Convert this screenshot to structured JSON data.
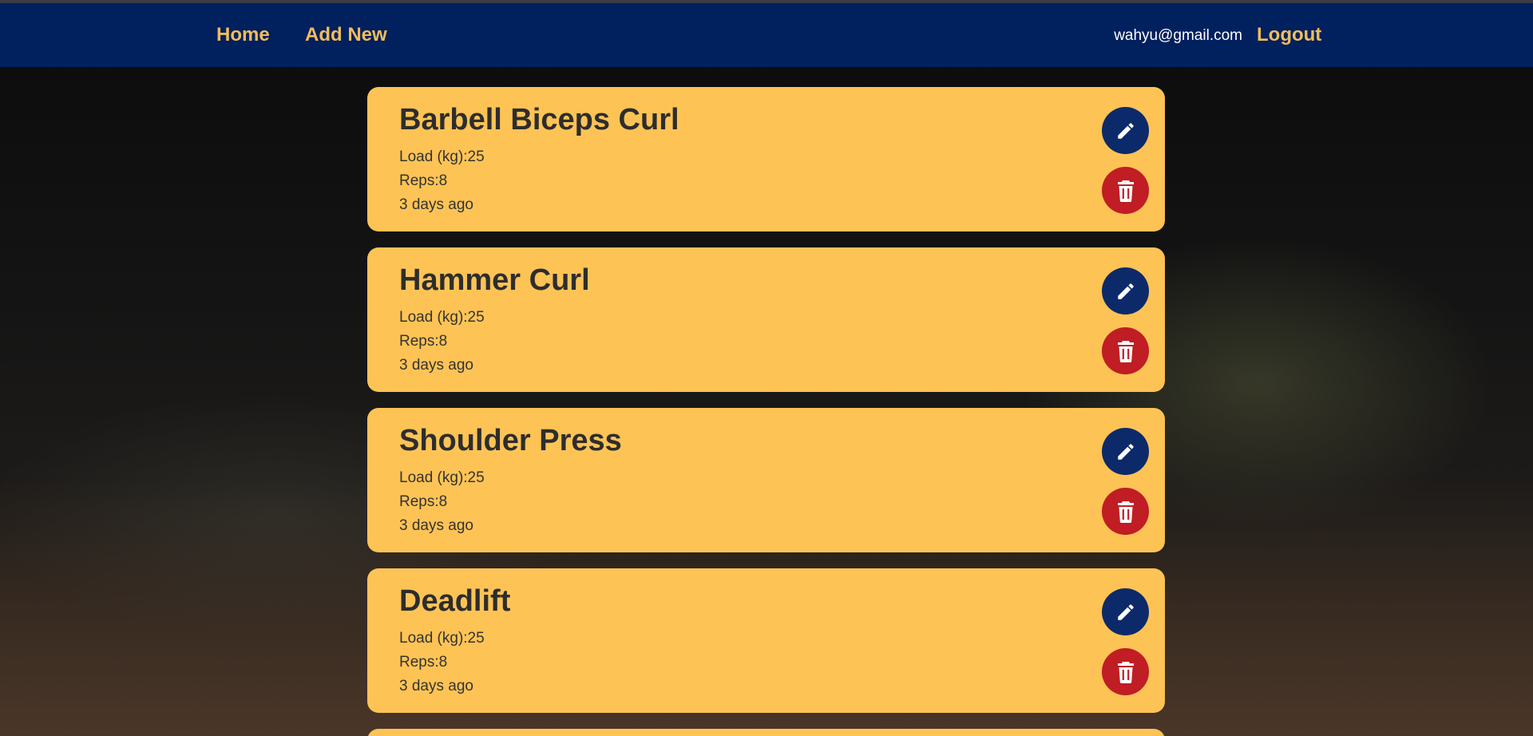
{
  "nav": {
    "home_label": "Home",
    "add_new_label": "Add New",
    "user_email": "wahyu@gmail.com",
    "logout_label": "Logout"
  },
  "colors": {
    "navbar": "#01205e",
    "nav_link": "#f2bd5a",
    "card": "#fec355",
    "edit_button": "#0c2a6a",
    "delete_button": "#c01d24"
  },
  "workouts": [
    {
      "title": "Barbell Biceps Curl",
      "load": "Load (kg):25",
      "reps": "Reps:8",
      "time": "3 days ago",
      "edit_icon": "pencil-icon",
      "delete_icon": "trash-icon"
    },
    {
      "title": "Hammer Curl",
      "load": "Load (kg):25",
      "reps": "Reps:8",
      "time": "3 days ago",
      "edit_icon": "pencil-icon",
      "delete_icon": "trash-icon"
    },
    {
      "title": "Shoulder Press",
      "load": "Load (kg):25",
      "reps": "Reps:8",
      "time": "3 days ago",
      "edit_icon": "pencil-icon",
      "delete_icon": "trash-icon"
    },
    {
      "title": "Deadlift",
      "load": "Load (kg):25",
      "reps": "Reps:8",
      "time": "3 days ago",
      "edit_icon": "pencil-icon",
      "delete_icon": "trash-icon"
    }
  ]
}
